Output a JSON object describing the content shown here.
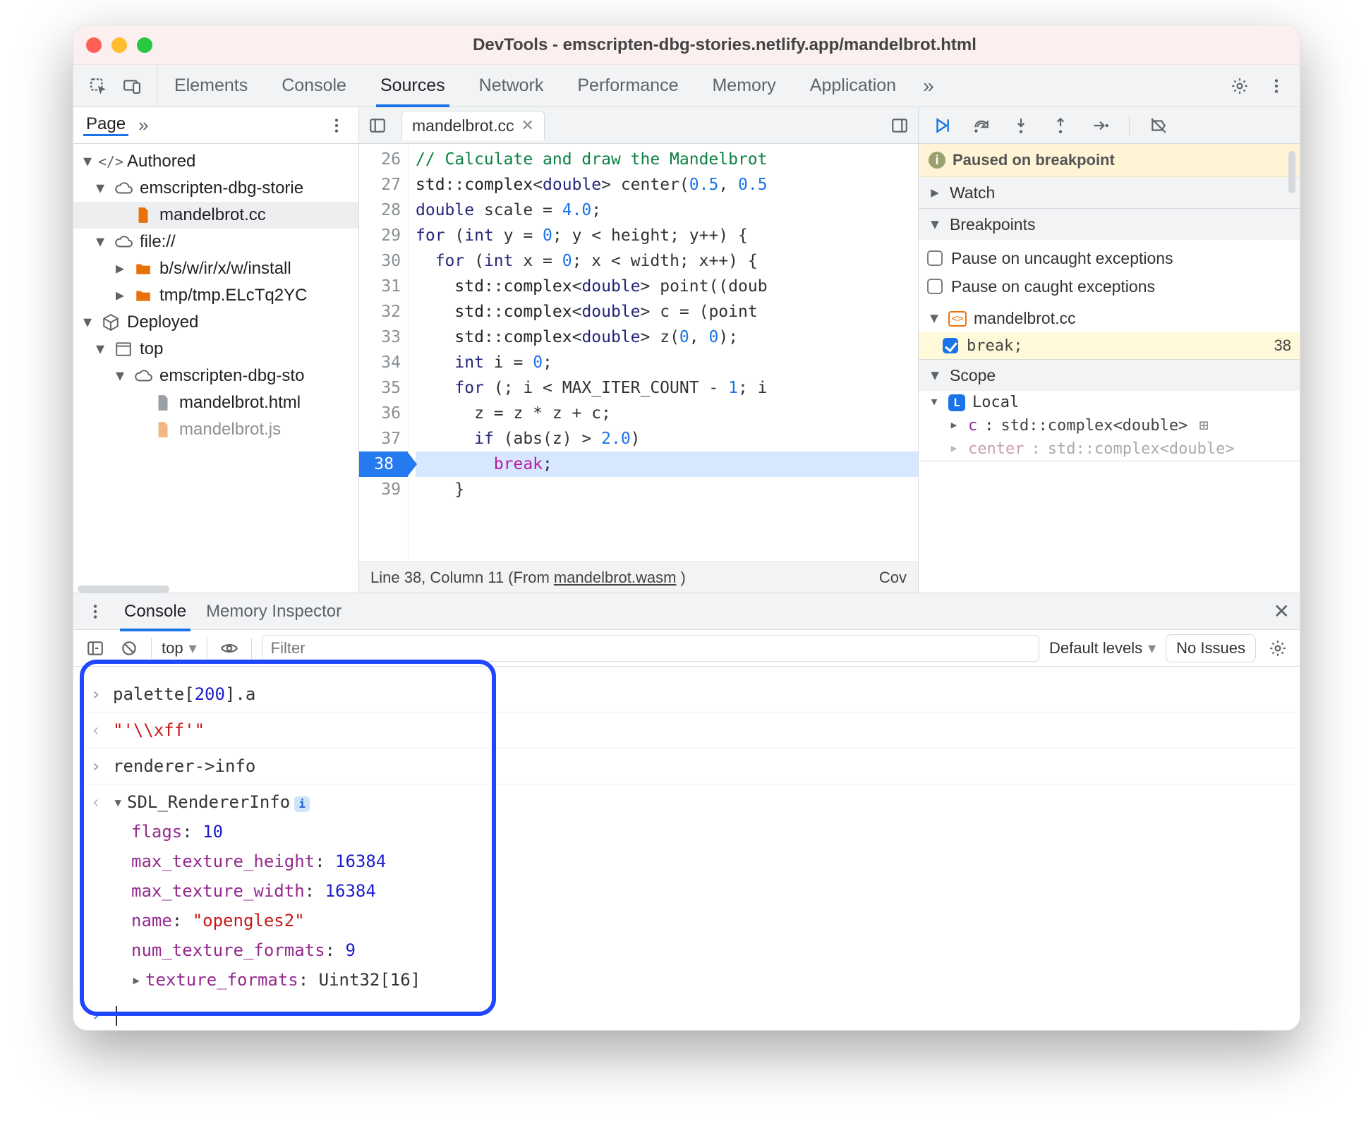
{
  "window": {
    "title": "DevTools - emscripten-dbg-stories.netlify.app/mandelbrot.html"
  },
  "tabstrip": {
    "tabs": [
      "Elements",
      "Console",
      "Sources",
      "Network",
      "Performance",
      "Memory",
      "Application"
    ],
    "active": "Sources",
    "more_glyph": "»"
  },
  "sidebar": {
    "page_label": "Page",
    "more_glyph": "»",
    "tree": {
      "authored_label": "Authored",
      "origin1": "emscripten-dbg-storie",
      "file1": "mandelbrot.cc",
      "file_scheme": "file://",
      "folder1": "b/s/w/ir/x/w/install",
      "folder2": "tmp/tmp.ELcTq2YC",
      "deployed_label": "Deployed",
      "top_label": "top",
      "origin2": "emscripten-dbg-sto",
      "file2": "mandelbrot.html",
      "file3": "mandelbrot.js"
    }
  },
  "editor": {
    "tab_name": "mandelbrot.cc",
    "first_line_no": 26,
    "lines": [
      "// Calculate and draw the Mandelbrot",
      "std::complex<double> center(0.5, 0.5",
      "double scale = 4.0;",
      "for (int y = 0; y < height; y++) {",
      "  for (int x = 0; x < width; x++) {",
      "    std::complex<double> point((doub",
      "    std::complex<double> c = (point ",
      "    std::complex<double> z(0, 0);",
      "    int i = 0;",
      "    for (; i < MAX_ITER_COUNT - 1; i",
      "      z = z * z + c;",
      "      if (abs(z) > 2.0)",
      "        break;",
      "    }"
    ],
    "exec_line_no": 38,
    "status_prefix": "Line 38, Column 11",
    "status_from": "(From ",
    "status_link": "mandelbrot.wasm",
    "status_suffix": ")",
    "status_cov": "Cov"
  },
  "debug": {
    "paused_label": "Paused on breakpoint",
    "watch_label": "Watch",
    "breakpoints_label": "Breakpoints",
    "pause_uncaught": "Pause on uncaught exceptions",
    "pause_caught": "Pause on caught exceptions",
    "bp_file": "mandelbrot.cc",
    "bp_text": "break;",
    "bp_line": "38",
    "scope_label": "Scope",
    "local_label": "Local",
    "scope_c_key": "c",
    "scope_c_val": "std::complex<double>",
    "scope_center_key": "center",
    "scope_center_val": "std::complex<double>"
  },
  "drawer": {
    "tabs": [
      "Console",
      "Memory Inspector"
    ],
    "active": "Console",
    "context": "top",
    "filter_placeholder": "Filter",
    "levels": "Default levels",
    "issues": "No Issues"
  },
  "console": {
    "in1": "palette[200].a",
    "out1": "\"'\\\\xff'\"",
    "in2": "renderer->info",
    "out2_type": "SDL_RendererInfo",
    "props": {
      "flags": "10",
      "max_texture_height": "16384",
      "max_texture_width": "16384",
      "name": "\"opengles2\"",
      "num_texture_formats": "9",
      "texture_formats": "Uint32[16]"
    }
  }
}
